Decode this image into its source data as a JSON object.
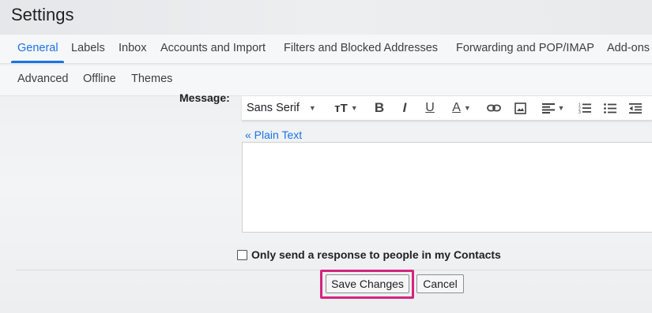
{
  "header": {
    "title": "Settings"
  },
  "tabs_row1": [
    {
      "label": "General",
      "active": true
    },
    {
      "label": "Labels"
    },
    {
      "label": "Inbox"
    },
    {
      "label": "Accounts and Import"
    },
    {
      "label": "Filters and Blocked Addresses"
    },
    {
      "label": "Forwarding and POP/IMAP"
    },
    {
      "label": "Add-ons"
    }
  ],
  "tabs_row2": [
    {
      "label": "Advanced"
    },
    {
      "label": "Offline"
    },
    {
      "label": "Themes"
    }
  ],
  "message": {
    "label": "Message:",
    "font_value": "Sans Serif",
    "plain_text_link": "« Plain Text",
    "body_value": ""
  },
  "contacts_checkbox": {
    "label": "Only send a response to people in my Contacts",
    "checked": false
  },
  "buttons": {
    "save": "Save Changes",
    "cancel": "Cancel"
  },
  "colors": {
    "accent": "#1a73e8",
    "highlight": "#d4247f"
  }
}
